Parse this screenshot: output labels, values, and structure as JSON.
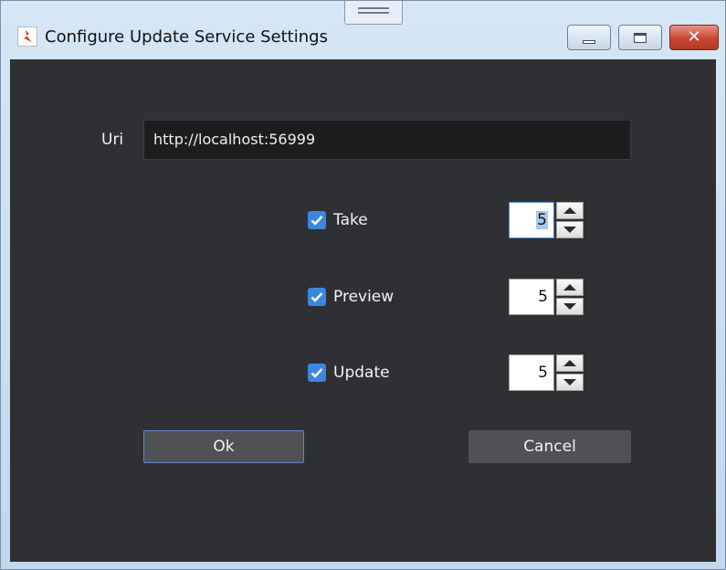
{
  "window": {
    "title": "Configure Update Service Settings"
  },
  "form": {
    "uri_label": "Uri",
    "uri_value": "http://localhost:56999",
    "options": [
      {
        "label": "Take",
        "checked": true,
        "value": "5"
      },
      {
        "label": "Preview",
        "checked": true,
        "value": "5"
      },
      {
        "label": "Update",
        "checked": true,
        "value": "5"
      }
    ]
  },
  "buttons": {
    "ok_label": "Ok",
    "cancel_label": "Cancel"
  },
  "colors": {
    "client_bg": "#2e3033",
    "checkbox_accent": "#3d86e0",
    "ok_focus_border": "#5c87c8",
    "close_button": "#c9462f"
  }
}
